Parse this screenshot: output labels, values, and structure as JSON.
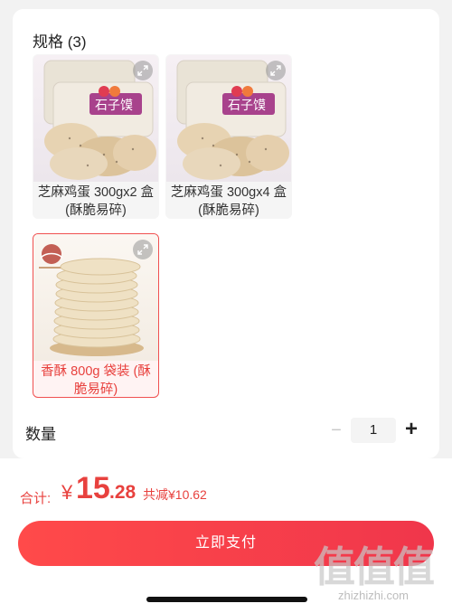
{
  "specs": {
    "title": "规格 (3)",
    "items": [
      {
        "label": "芝麻鸡蛋 300gx2 盒 (酥脆易碎)",
        "selected": false,
        "box_text": "石子馍"
      },
      {
        "label": "芝麻鸡蛋 300gx4 盒 (酥脆易碎)",
        "selected": false,
        "box_text": "石子馍"
      },
      {
        "label": "香酥 800g 袋装 (酥脆易碎)",
        "selected": true,
        "box_text": ""
      }
    ]
  },
  "quantity": {
    "label": "数量",
    "value": "1",
    "minus": "−",
    "plus": "+"
  },
  "footer": {
    "total_label": "合计:",
    "currency": "¥",
    "total_int": "15",
    "total_dec": ".28",
    "discount": "共减¥10.62",
    "pay_label": "立即支付"
  },
  "watermark": {
    "chars": "值值值",
    "url": "zhizhizhi.com"
  },
  "colors": {
    "accent": "#e8413e",
    "button": "#f0364b"
  }
}
